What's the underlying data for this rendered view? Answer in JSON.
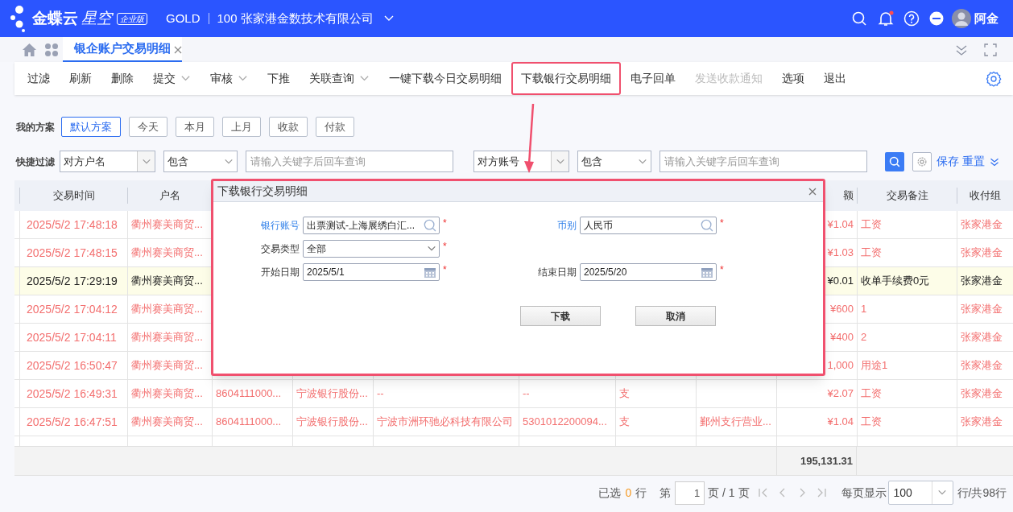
{
  "header": {
    "brand": "金蝶云",
    "product": "星空",
    "edition": "企业版",
    "tenant": "GOLD",
    "company": "100 张家港金数技术有限公司",
    "user": "阿金",
    "notification_dot": true
  },
  "tabs": [
    {
      "label": "银企账户交易明细",
      "selected": true
    }
  ],
  "toolbar": [
    {
      "label": "过滤",
      "menu": false,
      "disabled": false,
      "highlighted": false
    },
    {
      "label": "刷新",
      "menu": false,
      "disabled": false,
      "highlighted": false
    },
    {
      "label": "删除",
      "menu": false,
      "disabled": false,
      "highlighted": false
    },
    {
      "label": "提交",
      "menu": true,
      "disabled": false,
      "highlighted": false
    },
    {
      "label": "审核",
      "menu": true,
      "disabled": false,
      "highlighted": false
    },
    {
      "label": "下推",
      "menu": false,
      "disabled": false,
      "highlighted": false
    },
    {
      "label": "关联查询",
      "menu": true,
      "disabled": false,
      "highlighted": false
    },
    {
      "label": "一键下载今日交易明细",
      "menu": false,
      "disabled": false,
      "highlighted": false
    },
    {
      "label": "下载银行交易明细",
      "menu": false,
      "disabled": false,
      "highlighted": true
    },
    {
      "label": "电子回单",
      "menu": false,
      "disabled": false,
      "highlighted": false
    },
    {
      "label": "发送收款通知",
      "menu": false,
      "disabled": true,
      "highlighted": false
    },
    {
      "label": "选项",
      "menu": false,
      "disabled": false,
      "highlighted": false
    },
    {
      "label": "退出",
      "menu": false,
      "disabled": false,
      "highlighted": false
    }
  ],
  "schemes": {
    "label": "我的方案",
    "items": [
      {
        "label": "默认方案",
        "selected": true
      },
      {
        "label": "今天",
        "selected": false
      },
      {
        "label": "本月",
        "selected": false
      },
      {
        "label": "上月",
        "selected": false
      },
      {
        "label": "收款",
        "selected": false
      },
      {
        "label": "付款",
        "selected": false
      }
    ]
  },
  "quick_filter": {
    "label": "快捷过滤",
    "groups": [
      {
        "field": "对方户名",
        "operator": "包含",
        "placeholder": "请输入关键字后回车查询"
      },
      {
        "field": "对方账号",
        "operator": "包含",
        "placeholder": "请输入关键字后回车查询"
      }
    ],
    "save": "保存",
    "reset": "重置"
  },
  "table": {
    "headers": [
      "交易时间",
      "户名",
      "额",
      "交易备注",
      "收付组"
    ],
    "rows": [
      {
        "selected": false,
        "kind": "partly_covered",
        "cells": [
          "2025/5/2 17:48:18",
          "衢州赛美商贸...",
          "¥1.04",
          "工资",
          "张家港金"
        ]
      },
      {
        "selected": false,
        "kind": "partly_covered",
        "cells": [
          "2025/5/2 17:48:15",
          "衢州赛美商贸...",
          "¥1.03",
          "工资",
          "张家港金"
        ]
      },
      {
        "selected": true,
        "kind": "partly_covered",
        "cells": [
          "2025/5/2 17:29:19",
          "衢州赛美商贸...",
          "¥0.01",
          "收单手续费0元",
          "张家港金"
        ]
      },
      {
        "selected": false,
        "kind": "partly_covered",
        "cells": [
          "2025/5/2 17:04:12",
          "衢州赛美商贸...",
          "¥600",
          "1",
          "张家港金"
        ]
      },
      {
        "selected": false,
        "kind": "partly_covered",
        "cells": [
          "2025/5/2 17:04:11",
          "衢州赛美商贸...",
          "¥400",
          "2",
          "张家港金"
        ]
      },
      {
        "selected": false,
        "kind": "partly_covered",
        "cells": [
          "2025/5/2 16:50:47",
          "衢州赛美商贸...",
          "1,000",
          "用途1",
          "张家港金"
        ]
      },
      {
        "selected": false,
        "kind": "full",
        "cells": [
          "2025/5/2 16:49:31",
          "衢州赛美商贸...",
          "8604111000...",
          "宁波银行股份...",
          "--",
          "--",
          "支",
          null,
          "¥2.07",
          "工资",
          "张家港金"
        ]
      },
      {
        "selected": false,
        "kind": "full",
        "cells": [
          "2025/5/2 16:47:51",
          "衢州赛美商贸...",
          "8604111000...",
          "宁波银行股份...",
          "宁波市洲环驰必科技有限公司",
          "5301012200094...",
          "支",
          "鄞州支行营业...",
          "¥1.04",
          "工资",
          "张家港金"
        ]
      }
    ],
    "total": "195,131.31"
  },
  "pagination": {
    "selected_prefix": "已选",
    "selected_count": "0",
    "selected_suffix": "行",
    "page_prefix": "第",
    "page": "1",
    "page_suffix": "页 / 1 页",
    "page_size_label": "每页显示",
    "page_size": "100",
    "total": "行/共98行"
  },
  "dialog": {
    "title": "下载银行交易明细",
    "rows": [
      [
        {
          "label": "银行账号",
          "value": "出票测试-上海展绣白汇...",
          "kind": "lookup",
          "linked": true,
          "required": true
        },
        {
          "label": "币别",
          "value": "人民币",
          "kind": "lookup",
          "linked": true,
          "required": true
        }
      ],
      [
        {
          "label": "交易类型",
          "value": "全部",
          "kind": "select",
          "linked": false,
          "required": true
        }
      ],
      [
        {
          "label": "开始日期",
          "value": "2025/5/1",
          "kind": "date",
          "linked": false,
          "required": true
        },
        {
          "label": "结束日期",
          "value": "2025/5/20",
          "kind": "date",
          "linked": false,
          "required": true
        }
      ]
    ],
    "required_mark": "*",
    "buttons": [
      "下载",
      "取消"
    ]
  }
}
